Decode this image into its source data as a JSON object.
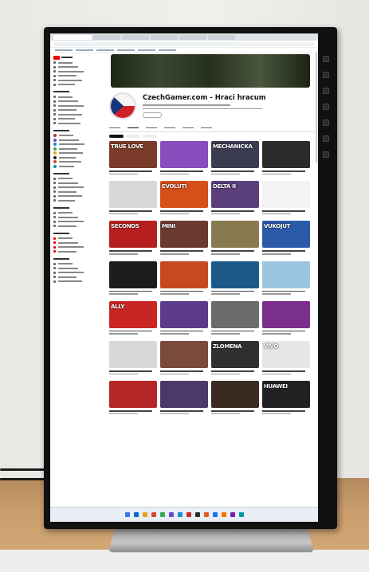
{
  "scene": {
    "colors": {
      "wall": "#ecebe7",
      "desk": "#c99d6c",
      "bezel": "#111111",
      "stand": "#a9a9a9"
    }
  },
  "browser": {
    "tab_count": 6
  },
  "youtube": {
    "logo_text": "YouTube",
    "channel": {
      "name": "CzechGamer.com - Hraci hracum",
      "avatar": "czech-flag-avatar"
    },
    "thumbnails": [
      {
        "caption": "TRUE LOVE",
        "bg": "#7a3b2a"
      },
      {
        "caption": "",
        "bg": "#8a4bbd"
      },
      {
        "caption": "MECHANICKA",
        "bg": "#3b3b52"
      },
      {
        "caption": "",
        "bg": "#2b2b2b"
      },
      {
        "caption": "",
        "bg": "#d8d8d8"
      },
      {
        "caption": "EVOLUTI",
        "bg": "#d44f1a"
      },
      {
        "caption": "DELTA II",
        "bg": "#5a3f7a"
      },
      {
        "caption": "",
        "bg": "#f3f3f3"
      },
      {
        "caption": "SECONDS",
        "bg": "#b51f1f"
      },
      {
        "caption": "MINI",
        "bg": "#6a3a2f"
      },
      {
        "caption": "",
        "bg": "#8a7a52"
      },
      {
        "caption": "VUKOJUT",
        "bg": "#2b5aa8"
      },
      {
        "caption": "",
        "bg": "#1c1c1c"
      },
      {
        "caption": "",
        "bg": "#c64a21"
      },
      {
        "caption": "",
        "bg": "#1d5a8a"
      },
      {
        "caption": "",
        "bg": "#9cc5e0"
      },
      {
        "caption": "ALLY",
        "bg": "#c92525"
      },
      {
        "caption": "",
        "bg": "#5c3b8a"
      },
      {
        "caption": "",
        "bg": "#6b6b6b"
      },
      {
        "caption": "",
        "bg": "#7a2f8a"
      },
      {
        "caption": "",
        "bg": "#d8d8d8"
      },
      {
        "caption": "",
        "bg": "#7a4b3a"
      },
      {
        "caption": "ZLOMENA",
        "bg": "#2f2f2f"
      },
      {
        "caption": "VIVO",
        "bg": "#e6e6e6"
      },
      {
        "caption": "",
        "bg": "#b42626"
      },
      {
        "caption": "",
        "bg": "#4a3a6a"
      },
      {
        "caption": "",
        "bg": "#3a2a22"
      },
      {
        "caption": "HUAWEI",
        "bg": "#222222"
      }
    ]
  },
  "taskbar": {
    "icon_colors": [
      "#2f7de1",
      "#0a64c8",
      "#e8a319",
      "#d04a2f",
      "#3aa654",
      "#6a4bd0",
      "#1c8ad8",
      "#c62828",
      "#2d2d2d",
      "#e05a1c",
      "#1a73e8",
      "#ff6f00",
      "#7b1fa2",
      "#0097a7"
    ]
  }
}
